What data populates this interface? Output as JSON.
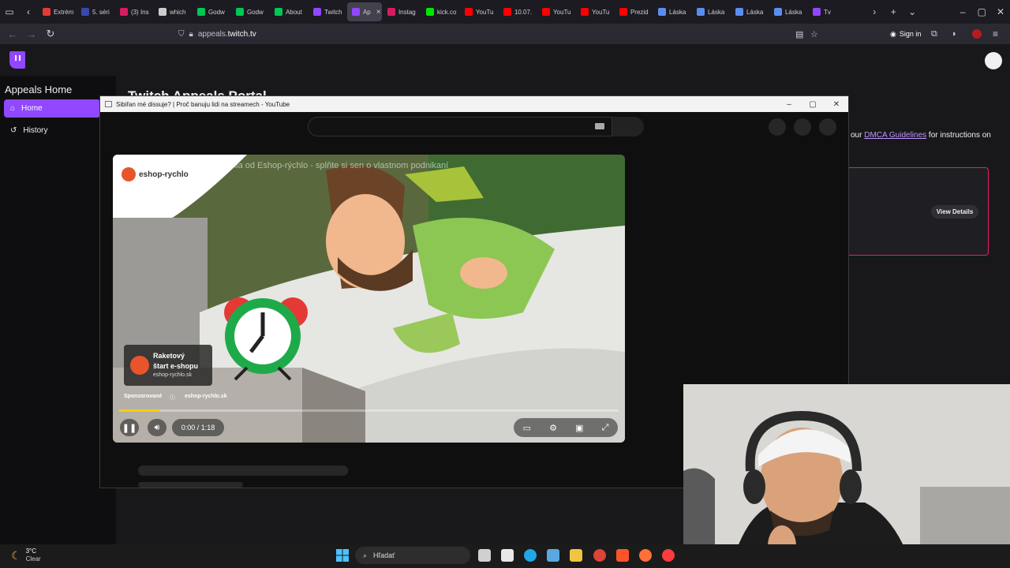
{
  "browser": {
    "tabs": [
      {
        "label": "Extrém",
        "color": "#e53935"
      },
      {
        "label": "5. séri",
        "color": "#3949ab"
      },
      {
        "label": "(3) Ins",
        "color": "#d81b60"
      },
      {
        "label": "which",
        "color": "#cccccc"
      },
      {
        "label": "Godw",
        "color": "#00c853"
      },
      {
        "label": "Godw",
        "color": "#00c853"
      },
      {
        "label": "About",
        "color": "#00c853"
      },
      {
        "label": "Twitch",
        "color": "#9147ff"
      },
      {
        "label": "Ap",
        "color": "#9147ff",
        "active": true
      },
      {
        "label": "Instag",
        "color": "#d81b60"
      },
      {
        "label": "kick.co",
        "color": "#00e701"
      },
      {
        "label": "YouTu",
        "color": "#ff0000"
      },
      {
        "label": "10.07.",
        "color": "#ff0000"
      },
      {
        "label": "YouTu",
        "color": "#ff0000"
      },
      {
        "label": "YouTu",
        "color": "#ff0000"
      },
      {
        "label": "Prezid",
        "color": "#ff0000"
      },
      {
        "label": "Láska",
        "color": "#5b8def"
      },
      {
        "label": "Láska",
        "color": "#5b8def"
      },
      {
        "label": "Láska",
        "color": "#5b8def"
      },
      {
        "label": "Láska",
        "color": "#5b8def"
      },
      {
        "label": "Tv",
        "color": "#9147ff"
      }
    ],
    "url_prefix": "appeals.",
    "url_host": "twitch.tv",
    "sign_in_label": "Sign in"
  },
  "twitch": {
    "sidebar_title": "Appeals Home",
    "nav_home": "Home",
    "nav_history": "History",
    "portal_title": "Twitch Appeals Portal",
    "dmca_prefix": "our ",
    "dmca_link": "DMCA Guidelines",
    "dmca_suffix": " for instructions on",
    "view_details": "View Details",
    "accent": "#9147ff"
  },
  "youtube_window": {
    "title": "Sibiřan mé dissuje? | Proč banuju lidi na streamech - YouTube",
    "ad_title": "Pracujem e-shopového riešenia od Eshop-rýchlo - splňte si sen o vlastnom podnikaní",
    "brand_name": "eshop-rychlo",
    "ad_card_line1": "Raketový",
    "ad_card_line2": "štart e-shopu",
    "ad_card_url": "eshop-rychlo.sk",
    "sponsored_label": "Sponzorované",
    "sponsor_info_icon": "ⓘ",
    "sponsor_url": "eshop-rychlo.sk",
    "time_display": "0:00 / 1:18",
    "progress_fraction": 0.08
  },
  "taskbar": {
    "temperature": "3°C",
    "condition": "Clear",
    "search_placeholder": "Hľadať"
  }
}
